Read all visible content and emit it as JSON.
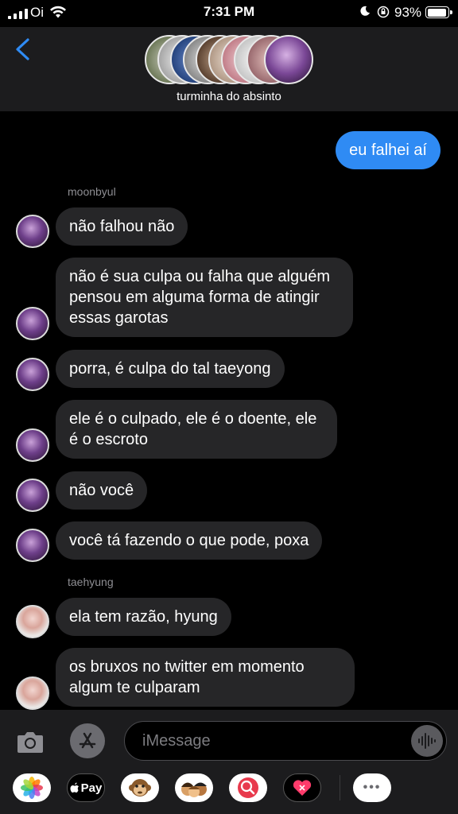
{
  "status": {
    "carrier": "Oi",
    "time": "7:31 PM",
    "battery_pct": "93%",
    "battery_level": 0.93
  },
  "header": {
    "group_name": "turminha do absinto",
    "back_icon": "chevron-left-icon"
  },
  "messages": [
    {
      "direction": "out",
      "text": "eu falhei aí"
    },
    {
      "direction": "sender",
      "text": "moonbyul"
    },
    {
      "direction": "in",
      "text": "não falhou não"
    },
    {
      "direction": "in",
      "text": "não é sua culpa ou falha que alguém pensou em alguma forma de atingir essas garotas"
    },
    {
      "direction": "in",
      "text": "porra, é culpa do tal taeyong"
    },
    {
      "direction": "in",
      "text": "ele é o culpado, ele é o doente, ele é o escroto"
    },
    {
      "direction": "in",
      "text": "não você"
    },
    {
      "direction": "in",
      "text": "você tá fazendo o que pode, poxa"
    },
    {
      "direction": "sender",
      "text": "taehyung"
    },
    {
      "direction": "in",
      "text": "ela tem razão, hyung"
    },
    {
      "direction": "in",
      "text": "os bruxos no twitter em momento algum te culparam"
    }
  ],
  "input": {
    "placeholder": "iMessage"
  },
  "apps": {
    "applepay_label": "Pay",
    "more_label": "•••"
  },
  "colors": {
    "background": "#000000",
    "header": "#1c1c1e",
    "bubble_in": "#262628",
    "bubble_out": "#2f8bf4",
    "accent": "#2f8bf4"
  }
}
